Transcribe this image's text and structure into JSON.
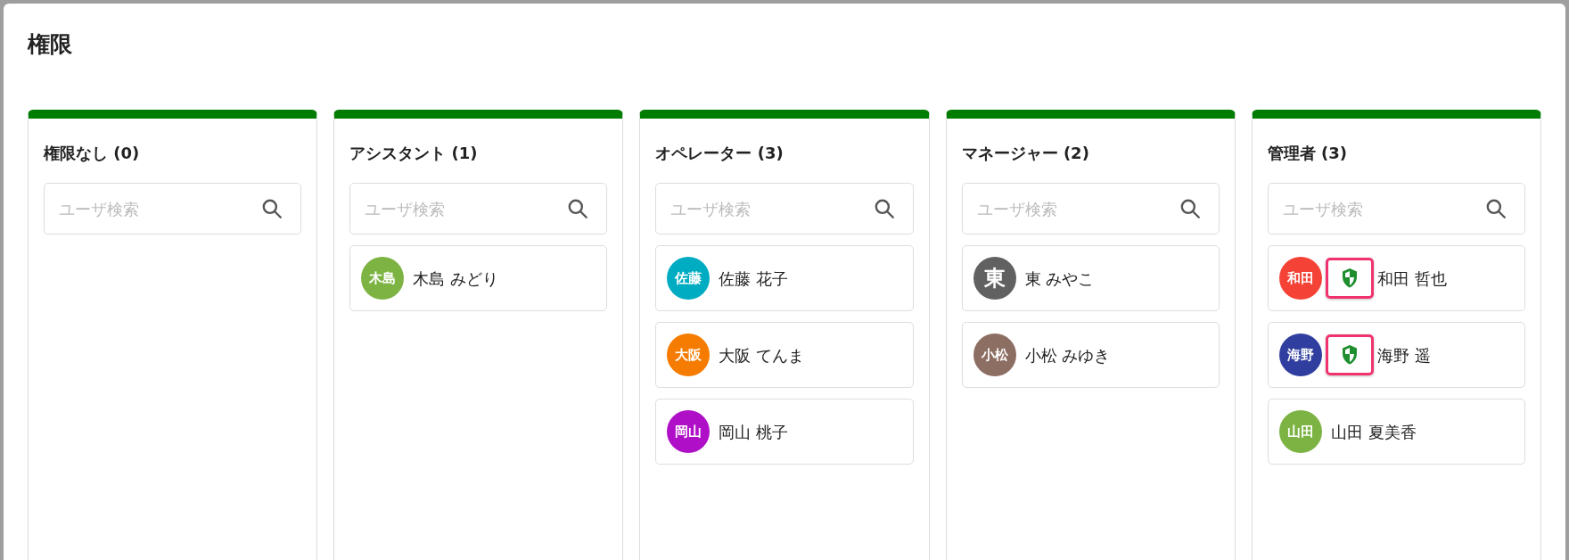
{
  "title": "権限",
  "columns": [
    {
      "heading": "権限なし (0)",
      "search": {
        "placeholder": "ユーザ検索"
      }
    },
    {
      "heading": "アシスタント (1)",
      "search": {
        "placeholder": "ユーザ検索"
      },
      "users": [
        {
          "avatar": "木島",
          "name": "木島 みどり",
          "color": "#7cb342",
          "shield": false
        }
      ]
    },
    {
      "heading": "オペレーター (3)",
      "search": {
        "placeholder": "ユーザ検索"
      },
      "users": [
        {
          "avatar": "佐藤",
          "name": "佐藤 花子",
          "color": "#00acc1",
          "shield": false
        },
        {
          "avatar": "大阪",
          "name": "大阪 てんま",
          "color": "#f57c00",
          "shield": false
        },
        {
          "avatar": "岡山",
          "name": "岡山 桃子",
          "color": "#b00fc8",
          "shield": false
        }
      ]
    },
    {
      "heading": "マネージャー (2)",
      "search": {
        "placeholder": "ユーザ検索"
      },
      "users": [
        {
          "avatar": "東",
          "name": "東 みやこ",
          "color": "#616161",
          "shield": false
        },
        {
          "avatar": "小松",
          "name": "小松 みゆき",
          "color": "#8d6e63",
          "shield": false
        }
      ]
    },
    {
      "heading": "管理者 (3)",
      "search": {
        "placeholder": "ユーザ検索"
      },
      "users": [
        {
          "avatar": "和田",
          "name": "和田 哲也",
          "color": "#f44336",
          "shield": true
        },
        {
          "avatar": "海野",
          "name": "海野 遥",
          "color": "#303f9f",
          "shield": true
        },
        {
          "avatar": "山田",
          "name": "山田 夏美香",
          "color": "#7cb342",
          "shield": false
        }
      ]
    }
  ]
}
